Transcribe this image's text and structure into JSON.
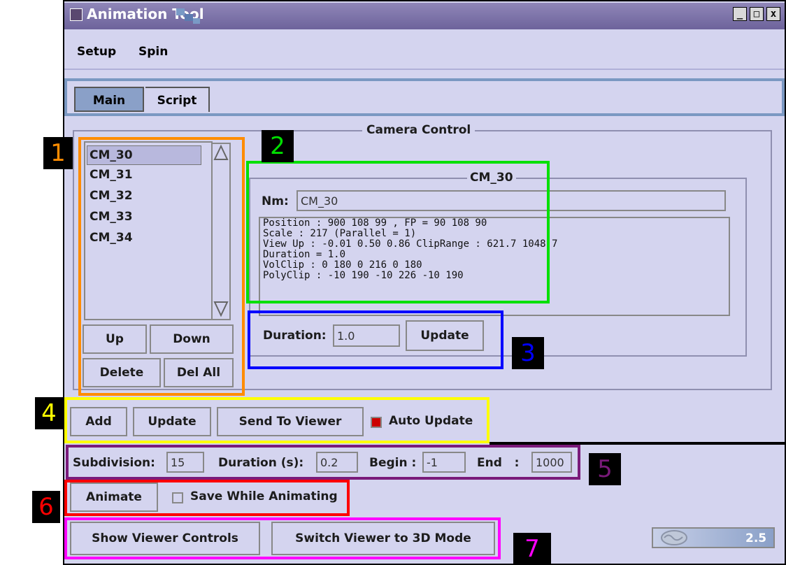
{
  "window": {
    "title": "Animation Tool",
    "controls": {
      "minimize": "_",
      "maximize": "□",
      "close": "x"
    }
  },
  "menu": {
    "setup": "Setup",
    "spin": "Spin"
  },
  "tabs": {
    "main": "Main",
    "script": "Script"
  },
  "camera_control": {
    "group_title": "Camera Control",
    "list": [
      "CM_30",
      "CM_31",
      "CM_32",
      "CM_33",
      "CM_34"
    ],
    "selected": "CM_30",
    "buttons": {
      "up": "Up",
      "down": "Down",
      "delete": "Delete",
      "del_all": "Del All"
    },
    "detail": {
      "group_title": "CM_30",
      "name_label": "Nm:",
      "name_value": "CM_30",
      "info_lines": [
        "Position :  900 108 99 , FP =  90 108 90",
        "Scale : 217 (Parallel = 1)",
        "View Up :  -0.01 0.50 0.86 ClipRange :  621.7 1048.7",
        "Duration = 1.0",
        "VolClip  :  0 180 0 216 0 180",
        "PolyClip :  -10 190 -10 226 -10 190"
      ]
    },
    "duration_label": "Duration:",
    "duration_value": "1.0",
    "update_button": "Update"
  },
  "row_actions": {
    "add": "Add",
    "update": "Update",
    "send_to_viewer": "Send To Viewer",
    "auto_update_label": "Auto Update",
    "auto_update_checked": true
  },
  "animation_params": {
    "subdivision_label": "Subdivision:",
    "subdivision_value": "15",
    "duration_label": "Duration (s):",
    "duration_value": "0.2",
    "begin_label": "Begin :",
    "begin_value": "-1",
    "end_label": "End   :",
    "end_value": "1000"
  },
  "animate": {
    "button": "Animate",
    "save_label": "Save While Animating",
    "save_checked": false
  },
  "viewer_buttons": {
    "show_controls": "Show Viewer Controls",
    "switch_3d": "Switch Viewer to 3D Mode"
  },
  "version": "2.5",
  "markers": [
    {
      "number": "1",
      "color": "#ff8c00"
    },
    {
      "number": "2",
      "color": "#00e000"
    },
    {
      "number": "3",
      "color": "#0000ff"
    },
    {
      "number": "4",
      "color": "#ffff00"
    },
    {
      "number": "5",
      "color": "#7a1a7a"
    },
    {
      "number": "6",
      "color": "#ff0000"
    },
    {
      "number": "7",
      "color": "#ff00ff"
    }
  ]
}
